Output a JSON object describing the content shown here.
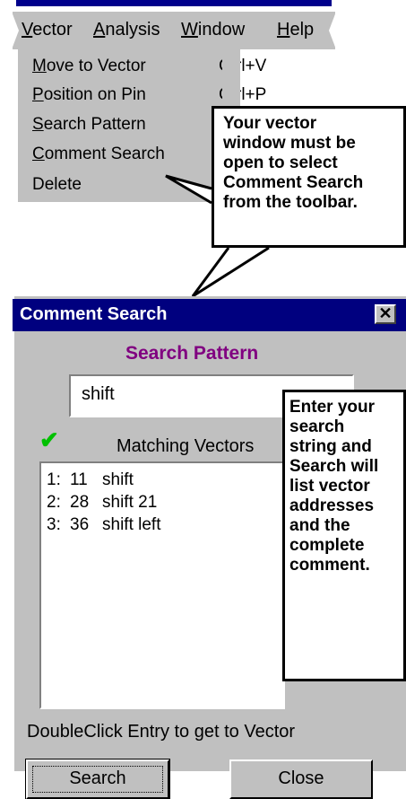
{
  "menubar": {
    "items": [
      {
        "label": "Vector",
        "underline": "V"
      },
      {
        "label": "Analysis",
        "underline": "A"
      },
      {
        "label": "Window",
        "underline": "W"
      },
      {
        "label": "Help",
        "underline": "H"
      }
    ]
  },
  "dropdown": {
    "items": [
      {
        "label": "Move to Vector",
        "shortcut": "Ctrl+V"
      },
      {
        "label": "Position on Pin",
        "shortcut": "Ctrl+P"
      },
      {
        "label": "Search Pattern",
        "shortcut": ""
      },
      {
        "label": "Comment Search",
        "shortcut": ""
      },
      {
        "label": "Delete",
        "shortcut": ""
      }
    ]
  },
  "callouts": {
    "top": [
      "Your vector",
      "window must be",
      "open to select",
      "Comment Search",
      "from the toolbar."
    ],
    "bottom": [
      "Enter your",
      "search",
      "string and",
      "Search will",
      "list vector",
      "addresses",
      "and the",
      "complete",
      "comment."
    ]
  },
  "dialog": {
    "title": "Comment Search",
    "close_glyph": "✕",
    "heading": "Search Pattern",
    "search_value": "shift",
    "matching_label": "Matching Vectors",
    "results": [
      {
        "index": "1:",
        "address": "11",
        "comment": "shift"
      },
      {
        "index": "2:",
        "address": "28",
        "comment": "shift 21"
      },
      {
        "index": "3:",
        "address": "36",
        "comment": "shift left"
      }
    ],
    "hint": "DoubleClick Entry to get to Vector",
    "search_button": "Search",
    "close_button": "Close"
  },
  "colors": {
    "titlebar": "#00007f",
    "heading": "#800080",
    "check": "#00c000",
    "face": "#c0c0c0"
  }
}
